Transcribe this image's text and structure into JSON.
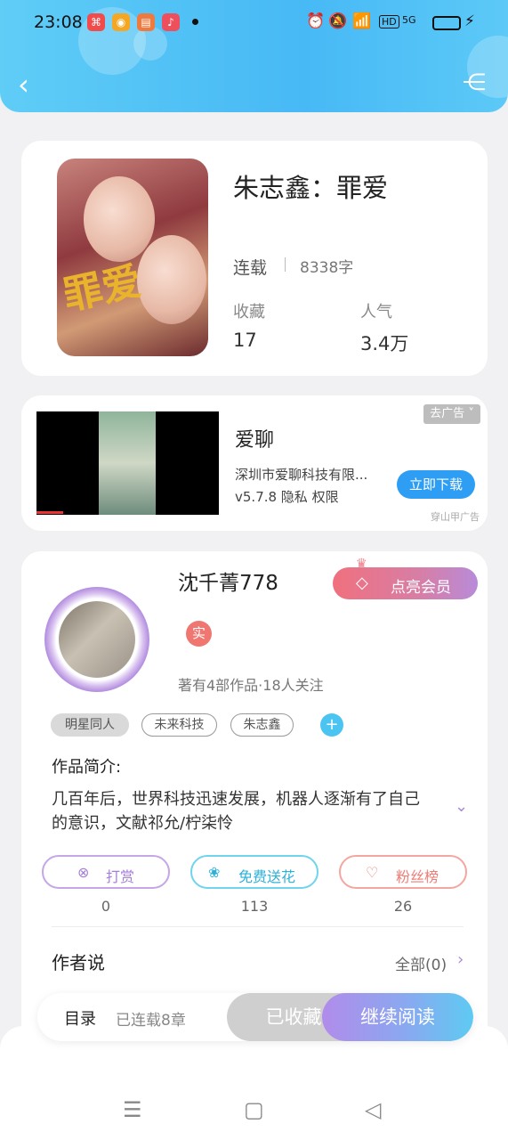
{
  "status_bar": {
    "time": "23:08",
    "app_icons": [
      "xiaohongshu-icon",
      "weibo-icon",
      "reader-icon",
      "music-icon"
    ],
    "network": "5G",
    "hd_label": "HD"
  },
  "header": {
    "back_icon": "chevron-left-icon",
    "share_icon": "share-icon",
    "gradient": [
      "#5fcdf6",
      "#47b9f5"
    ]
  },
  "book": {
    "title": "朱志鑫：罪爱",
    "status": "连载",
    "word_count": "8338字",
    "stats": [
      {
        "label": "收藏",
        "value": "17"
      },
      {
        "label": "人气",
        "value": "3.4万"
      }
    ],
    "cover_text": "罪爱"
  },
  "ad": {
    "app_name": "爱聊",
    "company": "深圳市爱聊科技有限...",
    "version_line": "v5.7.8 隐私 权限",
    "remove_label": "去广告",
    "download_label": "立即下载",
    "source": "穿山甲广告"
  },
  "author": {
    "name": "沈千菁778",
    "real_badge": "实",
    "meta": "著有4部作品·18人关注",
    "vip_label": "点亮会员",
    "tags": [
      "明星同人",
      "未来科技",
      "朱志鑫"
    ],
    "intro_title": "作品简介:",
    "intro_text": "几百年后，世界科技迅速发展，机器人逐渐有了自己的意识，文献祁允/柠柒怜",
    "actions": [
      {
        "label": "打赏",
        "icon": "yen-coin-icon",
        "count": "0",
        "color": "#a57ed6"
      },
      {
        "label": "免费送花",
        "icon": "flower-icon",
        "count": "113",
        "color": "#2cb1d9"
      },
      {
        "label": "粉丝榜",
        "icon": "fans-heart-icon",
        "count": "26",
        "color": "#ee7d76"
      }
    ],
    "says_title": "作者说",
    "says_all": "全部(0)"
  },
  "bottom_bar": {
    "catalog": "目录",
    "chapters": "已连载8章",
    "collected": "已收藏",
    "continue": "继续阅读"
  },
  "nav": [
    "menu-icon",
    "home-square-icon",
    "back-triangle-icon"
  ]
}
